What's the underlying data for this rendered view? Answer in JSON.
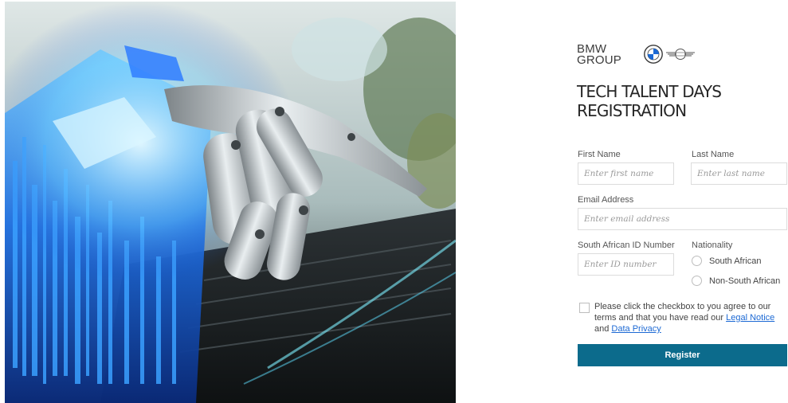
{
  "brand": {
    "group_line1": "BMW",
    "group_line2": "GROUP",
    "icons": [
      "bmw-roundel-icon",
      "mini-logo-icon"
    ]
  },
  "title": {
    "line1": "TECH TALENT DAYS",
    "line2": "REGISTRATION"
  },
  "form": {
    "first_name": {
      "label": "First Name",
      "placeholder": "Enter first name",
      "value": ""
    },
    "last_name": {
      "label": "Last Name",
      "placeholder": "Enter last name",
      "value": ""
    },
    "email": {
      "label": "Email Address",
      "placeholder": "Enter email address",
      "value": ""
    },
    "id_number": {
      "label": "South African ID Number",
      "placeholder": "Enter ID number",
      "value": ""
    },
    "nationality": {
      "label": "Nationality",
      "options": [
        "South African",
        "Non-South African"
      ],
      "selected": null
    },
    "consent": {
      "text_before": "Please click the checkbox to you agree to our terms and that you have read our ",
      "legal_link": "Legal Notice",
      "text_between": " and ",
      "privacy_link": "Data Privacy",
      "checked": false
    },
    "submit_label": "Register"
  },
  "colors": {
    "accent": "#0c6b8c",
    "link": "#1c69d4",
    "border": "#dcdcdc"
  }
}
